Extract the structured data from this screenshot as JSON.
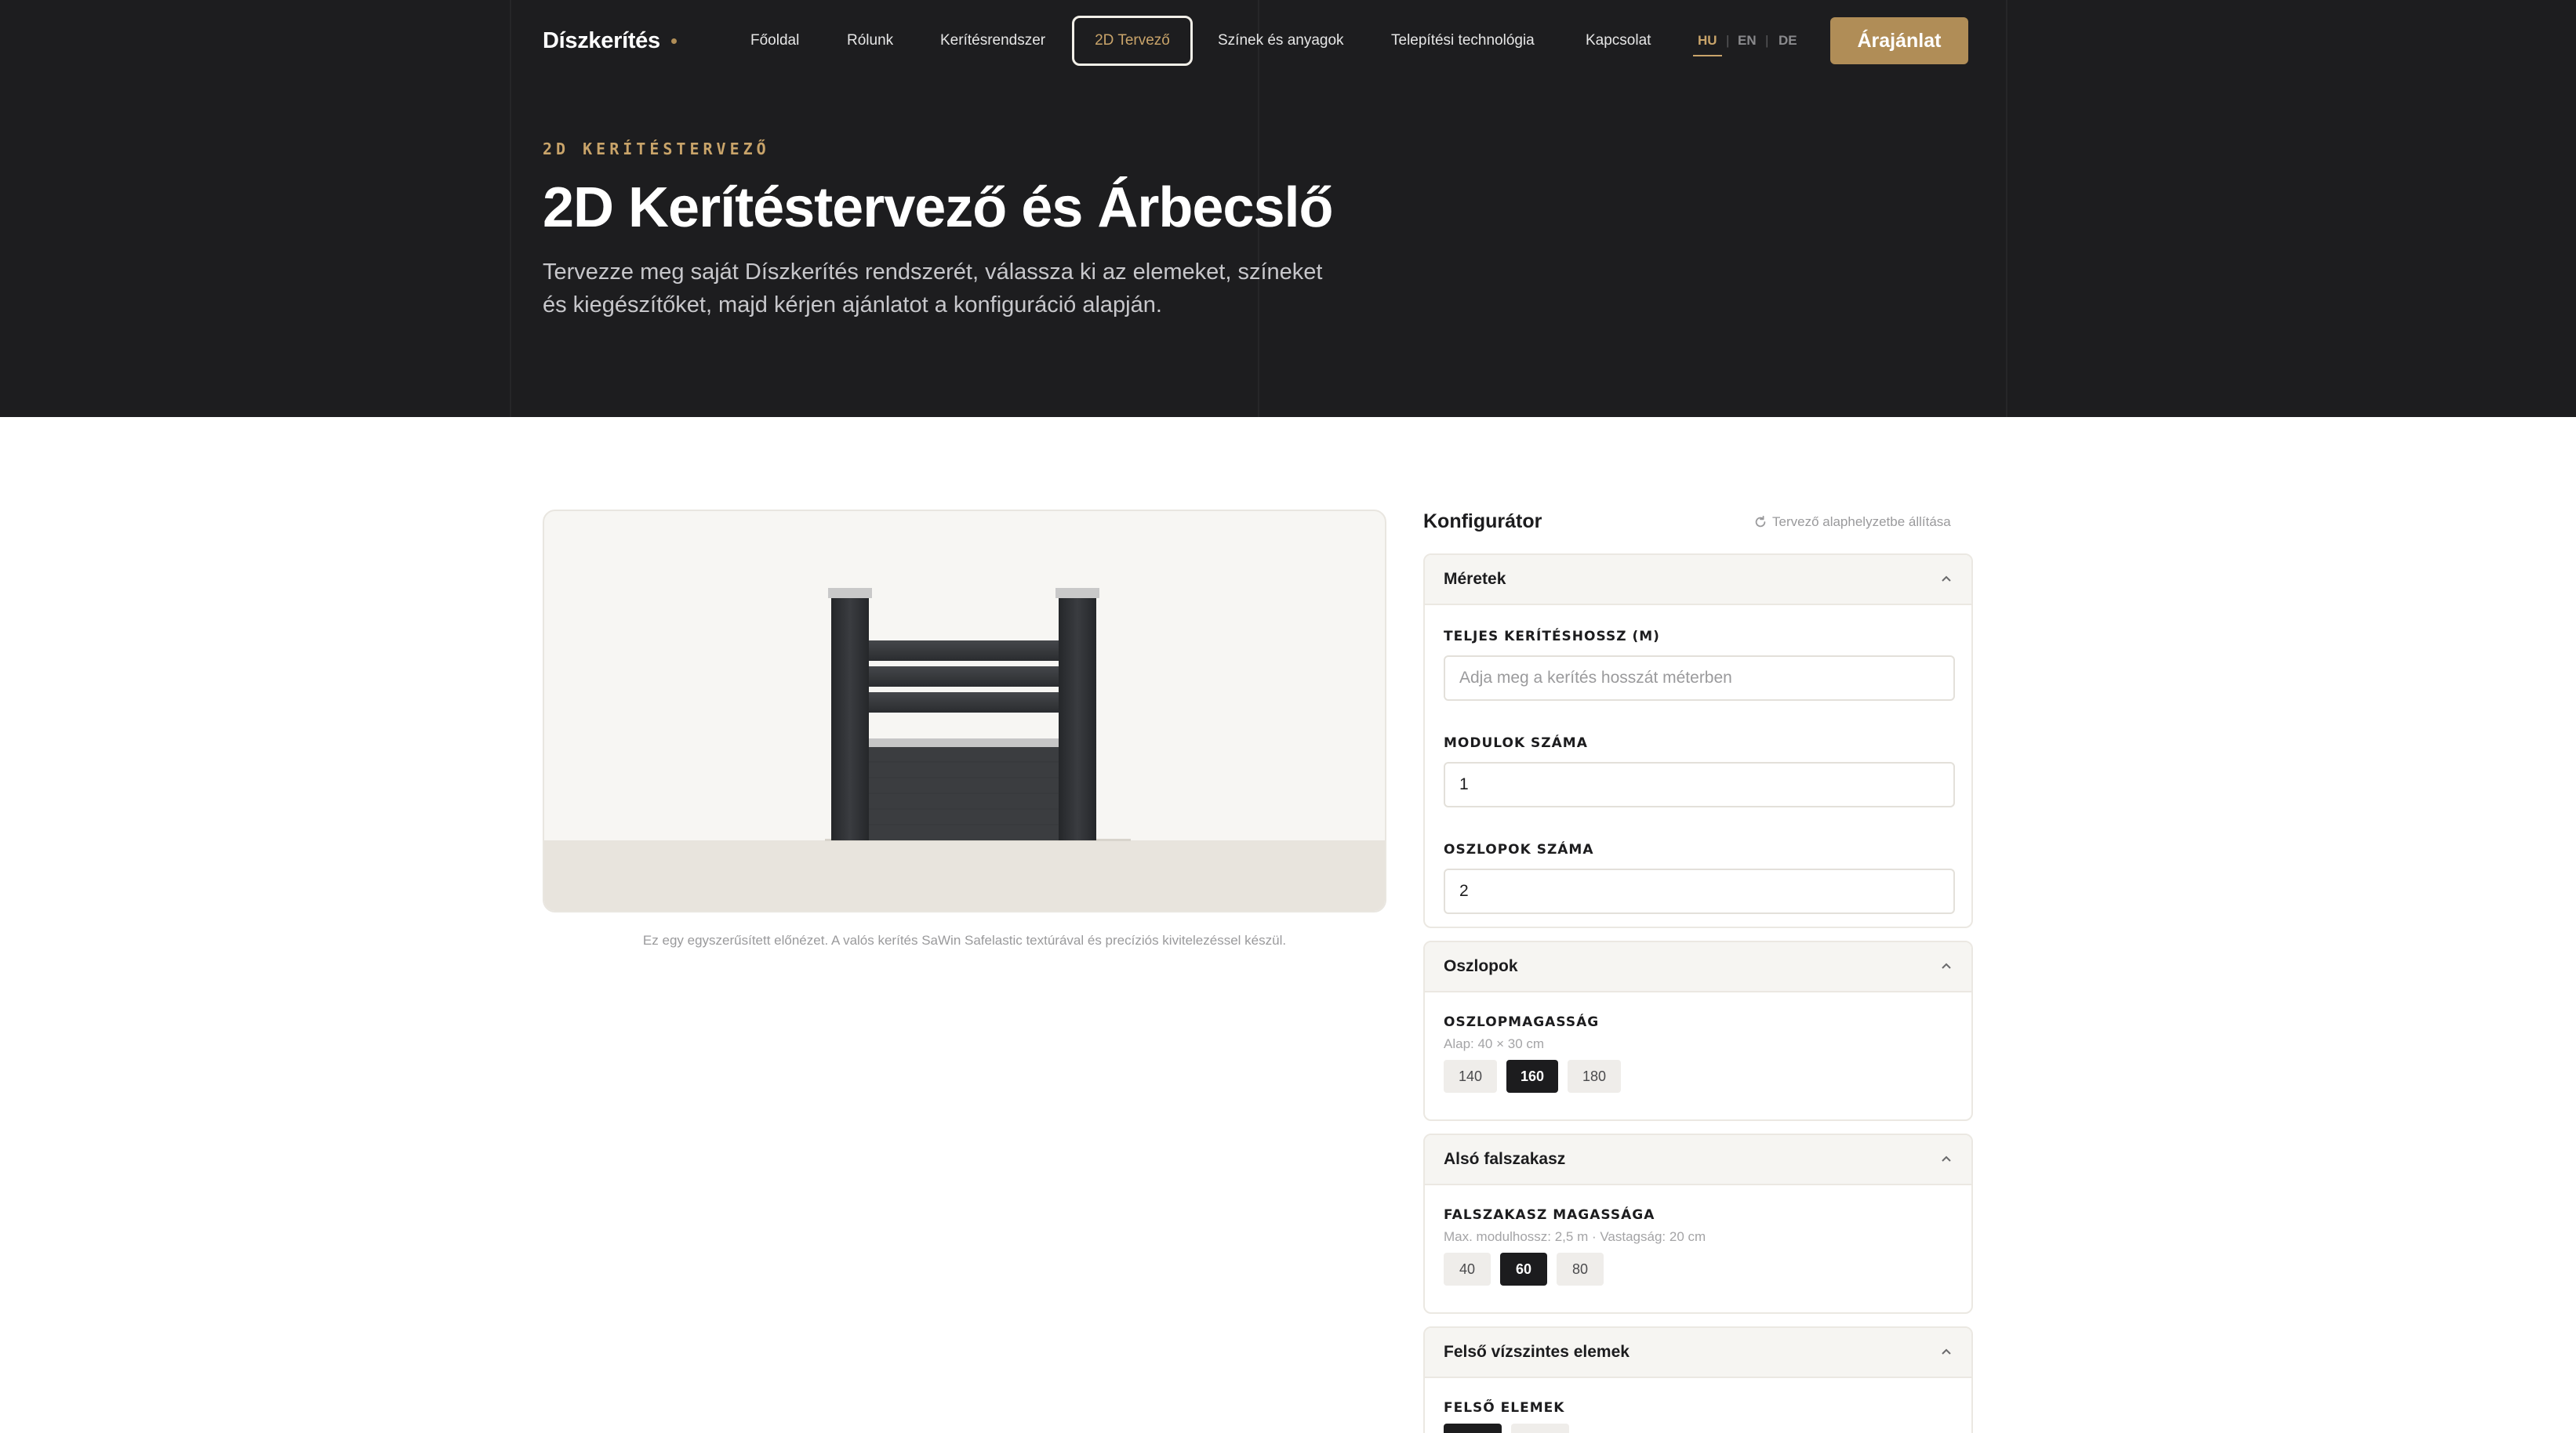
{
  "brand": {
    "name": "Díszkerítés",
    "accent": "#b08d57",
    "dark_bg": "#1d1d1f"
  },
  "nav": {
    "items": [
      "Főoldal",
      "Rólunk",
      "Kerítésrendszer",
      "2D Tervező",
      "Színek és anyagok",
      "Telepítési technológia",
      "Kapcsolat"
    ],
    "active": "2D Tervező"
  },
  "languages": {
    "items": [
      "HU",
      "EN",
      "DE"
    ],
    "active": "HU",
    "separator": "|"
  },
  "cta_label": "Árajánlat",
  "hero": {
    "eyebrow": "2D KERÍTÉSTERVEZŐ",
    "title": "2D Kerítéstervező és Árbecslő",
    "subtitle": "Tervezze meg saját Díszkerítés rendszerét, válassza ki az elemeket, színeket és kiegészítőket, majd kérjen ajánlatot a konfiguráció alapján."
  },
  "preview": {
    "caption": "Ez egy egyszerűsített előnézet. A valós kerítés SaWin Safelastic textúrával és precíziós kivitelezéssel készül.",
    "colors": {
      "post": "#2e3033",
      "cap": "#c9c9c9",
      "rail": "#35373a",
      "wall": "#3a3c3f",
      "wall_cap": "#c4c4c4",
      "sky": "#f7f6f3",
      "ground": "#e8e4dd"
    }
  },
  "configurator": {
    "title": "Konfigurátor",
    "reset_label": "Tervező alaphelyzetbe állítása",
    "reset_icon": "refresh-icon",
    "sections": {
      "dimensions": {
        "title": "Méretek",
        "length_label": "TELJES KERÍTÉSHOSSZ (M)",
        "length_placeholder": "Adja meg a kerítés hosszát méterben",
        "length_value": "",
        "modules_label": "MODULOK SZÁMA",
        "modules_value": "1",
        "posts_label": "OSZLOPOK SZÁMA",
        "posts_value": "2"
      },
      "posts": {
        "title": "Oszlopok",
        "height_label": "OSZLOPMAGASSÁG",
        "height_note": "Alap: 40 × 30 cm",
        "options": [
          "140",
          "160",
          "180"
        ],
        "selected": "160"
      },
      "lower_wall": {
        "title": "Alsó falszakasz",
        "height_label": "FALSZAKASZ MAGASSÁGA",
        "height_note": "Max. modulhossz: 2,5 m · Vastagság: 20 cm",
        "options": [
          "40",
          "60",
          "80"
        ],
        "selected": "60"
      },
      "top_elements": {
        "title": "Felső vízszintes elemek",
        "elements_label": "FELSŐ ELEMEK"
      }
    }
  }
}
